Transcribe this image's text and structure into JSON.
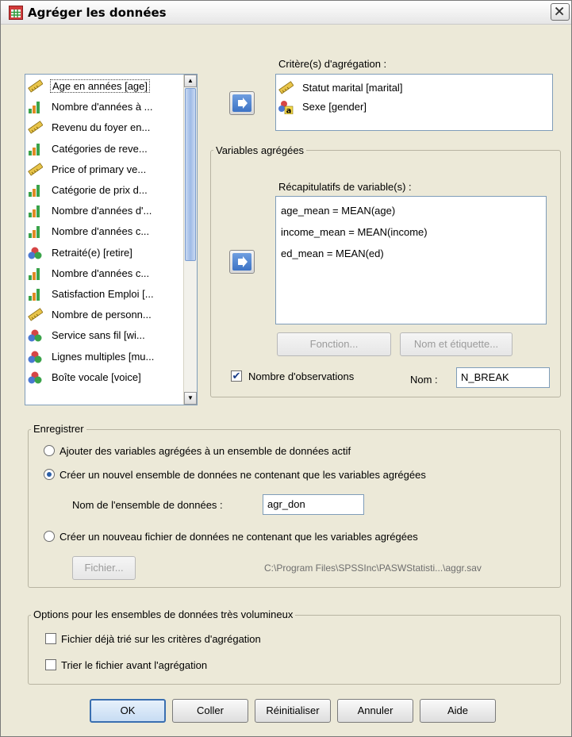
{
  "window": {
    "title": "Agréger les données"
  },
  "variables": [
    {
      "label": "Age en années [age]",
      "icon": "scale-icon"
    },
    {
      "label": "Nombre d'années à ...",
      "icon": "ordinal-icon"
    },
    {
      "label": "Revenu du foyer en...",
      "icon": "scale-icon"
    },
    {
      "label": "Catégories de reve...",
      "icon": "ordinal-icon"
    },
    {
      "label": "Price of primary ve...",
      "icon": "scale-icon"
    },
    {
      "label": "Catégorie de prix d...",
      "icon": "ordinal-icon"
    },
    {
      "label": "Nombre d'années d'...",
      "icon": "ordinal-icon"
    },
    {
      "label": "Nombre d'années c...",
      "icon": "ordinal-icon"
    },
    {
      "label": "Retraité(e) [retire]",
      "icon": "nominal-icon"
    },
    {
      "label": "Nombre d'années c...",
      "icon": "ordinal-icon"
    },
    {
      "label": "Satisfaction Emploi [...",
      "icon": "ordinal-icon"
    },
    {
      "label": "Nombre de personn...",
      "icon": "scale-icon"
    },
    {
      "label": "Service sans fil [wi...",
      "icon": "nominal-icon"
    },
    {
      "label": "Lignes multiples [mu...",
      "icon": "nominal-icon"
    },
    {
      "label": "Boîte vocale [voice]",
      "icon": "nominal-icon"
    }
  ],
  "break": {
    "label": "Critère(s) d'agrégation :",
    "items": [
      {
        "label": "Statut marital [marital]",
        "icon": "scale-icon"
      },
      {
        "label": "Sexe [gender]",
        "icon": "nominal-string-icon"
      }
    ]
  },
  "aggregated": {
    "group_title": "Variables agrégées",
    "summaries_label": "Récapitulatifs de variable(s) :",
    "items": [
      "age_mean = MEAN(age)",
      "income_mean = MEAN(income)",
      "ed_mean = MEAN(ed)"
    ],
    "function_button": "Fonction...",
    "name_label_button": "Nom et étiquette...",
    "num_cases_label": "Nombre d'observations",
    "num_cases_checked": true,
    "name_label": "Nom :",
    "name_value": "N_BREAK"
  },
  "save": {
    "group_title": "Enregistrer",
    "option_add": "Ajouter des variables agrégées à un ensemble de données actif",
    "option_new_dataset": "Créer un nouvel ensemble de données ne contenant que les variables agrégées",
    "dataset_name_label": "Nom de l'ensemble de données :",
    "dataset_name_value": "agr_don",
    "option_new_file": "Créer un nouveau fichier de données ne contenant que les variables agrégées",
    "file_button": "Fichier...",
    "file_path": "C:\\Program Files\\SPSSInc\\PASWStatisti...\\aggr.sav",
    "selected": "new_dataset"
  },
  "options": {
    "group_title": "Options pour les ensembles de données très volumineux",
    "presorted": "Fichier déjà trié sur les critères d'agrégation",
    "sort_before": "Trier le fichier avant l'agrégation"
  },
  "buttons": {
    "ok": "OK",
    "paste": "Coller",
    "reset": "Réinitialiser",
    "cancel": "Annuler",
    "help": "Aide"
  }
}
